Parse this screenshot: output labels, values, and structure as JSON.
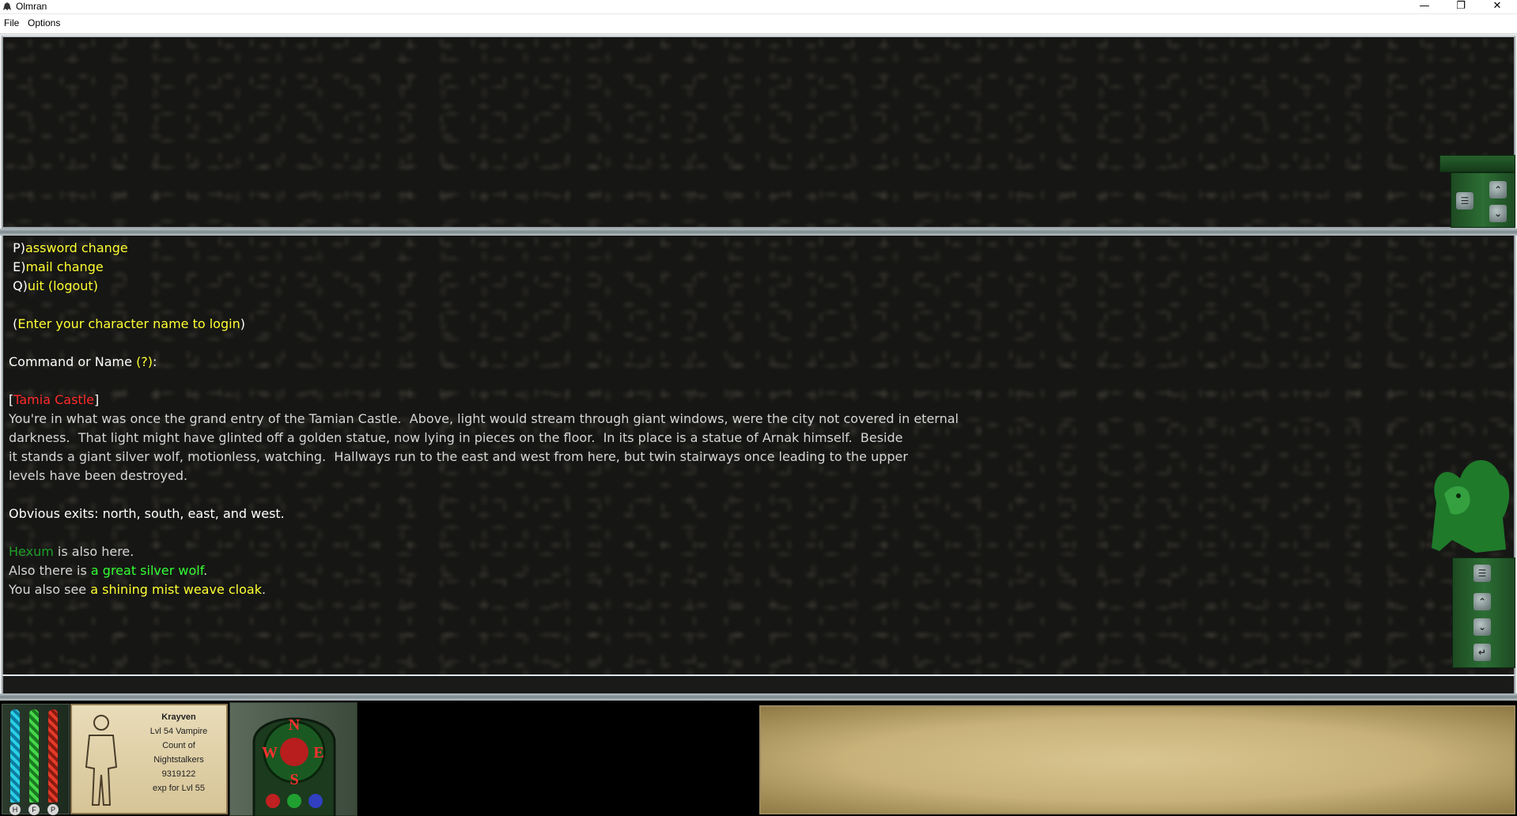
{
  "window": {
    "title": "Olmran",
    "minimize": "—",
    "maximize": "❐",
    "close": "✕"
  },
  "menu": {
    "file": "File",
    "options": "Options"
  },
  "output": [
    [
      {
        "t": " P)",
        "c": "white"
      },
      {
        "t": "assword change",
        "c": "yellow"
      }
    ],
    [
      {
        "t": " E)",
        "c": "white"
      },
      {
        "t": "mail change",
        "c": "yellow"
      }
    ],
    [
      {
        "t": " Q)",
        "c": "white"
      },
      {
        "t": "uit (logout)",
        "c": "yellow"
      }
    ],
    [],
    [
      {
        "t": " (",
        "c": "white"
      },
      {
        "t": "Enter your character name to login",
        "c": "yellow"
      },
      {
        "t": ")",
        "c": "white"
      }
    ],
    [],
    [
      {
        "t": "Command or Name ",
        "c": "white"
      },
      {
        "t": "(?)",
        "c": "yellow"
      },
      {
        "t": ":",
        "c": "white"
      }
    ],
    [],
    [
      {
        "t": "[",
        "c": "white"
      },
      {
        "t": "Tamia Castle",
        "c": "red"
      },
      {
        "t": "]",
        "c": "white"
      }
    ],
    [
      {
        "t": "You're in what was once the grand entry of the Tamian Castle.  Above, light would stream through giant windows, were the city not covered in eternal",
        "c": "gray"
      }
    ],
    [
      {
        "t": "darkness.  That light might have glinted off a golden statue, now lying in pieces on the floor.  In its place is a statue of Arnak himself.  Beside",
        "c": "gray"
      }
    ],
    [
      {
        "t": "it stands a giant silver wolf, motionless, watching.  Hallways run to the east and west from here, but twin stairways once leading to the upper",
        "c": "gray"
      }
    ],
    [
      {
        "t": "levels have been destroyed.",
        "c": "gray"
      }
    ],
    [],
    [
      {
        "t": "Obvious exits: north, south, east, and west.",
        "c": "white"
      }
    ],
    [],
    [
      {
        "t": "Hexum",
        "c": "dkgreen"
      },
      {
        "t": " is also here.",
        "c": "gray"
      }
    ],
    [
      {
        "t": "Also there is ",
        "c": "gray"
      },
      {
        "t": "a great silver wolf",
        "c": "ltgreen"
      },
      {
        "t": ".",
        "c": "gray"
      }
    ],
    [
      {
        "t": "You also see ",
        "c": "gray"
      },
      {
        "t": "a shining mist weave cloak",
        "c": "yellow"
      },
      {
        "t": ".",
        "c": "gray"
      }
    ]
  ],
  "input": {
    "value": ""
  },
  "stats": {
    "h": "H",
    "f": "F",
    "p": "P"
  },
  "character": {
    "name": "Krayven",
    "level_class": "Lvl 54 Vampire",
    "title_line1": "Count of",
    "title_line2": "Nightstalkers",
    "exp": "9319122",
    "exp_label": "exp for Lvl 55"
  },
  "compass": {
    "n": "N",
    "s": "S",
    "e": "E",
    "w": "W"
  },
  "colors": {
    "white": "#ffffff",
    "yellow": "#ffff33",
    "gray": "#d6d6d6",
    "red": "#ff2a2a",
    "dkgreen": "#1fa02c",
    "ltgreen": "#33ff33"
  },
  "icons": {
    "app": "gargoyle-icon",
    "chat": "chat-bubble-icon",
    "scroll_up": "chevron-up-icon",
    "scroll_down": "chevron-down-icon",
    "return": "return-icon"
  }
}
